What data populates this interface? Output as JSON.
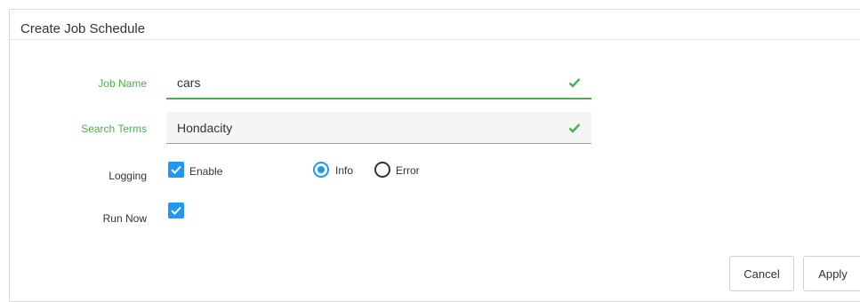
{
  "dialog": {
    "title": "Create Job Schedule"
  },
  "form": {
    "job_name": {
      "label": "Job Name",
      "value": "cars"
    },
    "search_terms": {
      "label": "Search Terms",
      "value": "Hondacity"
    },
    "logging": {
      "label": "Logging",
      "enable_label": "Enable",
      "enable_checked": true,
      "level_options": [
        "Info",
        "Error"
      ],
      "selected_level": "Info"
    },
    "run_now": {
      "label": "Run Now",
      "checked": true
    }
  },
  "buttons": {
    "cancel": "Cancel",
    "apply": "Apply"
  },
  "colors": {
    "accent_green": "#4caf50",
    "accent_blue": "#2196f3"
  },
  "icons": {
    "valid": "check-icon",
    "checkbox": "checkmark-icon"
  }
}
